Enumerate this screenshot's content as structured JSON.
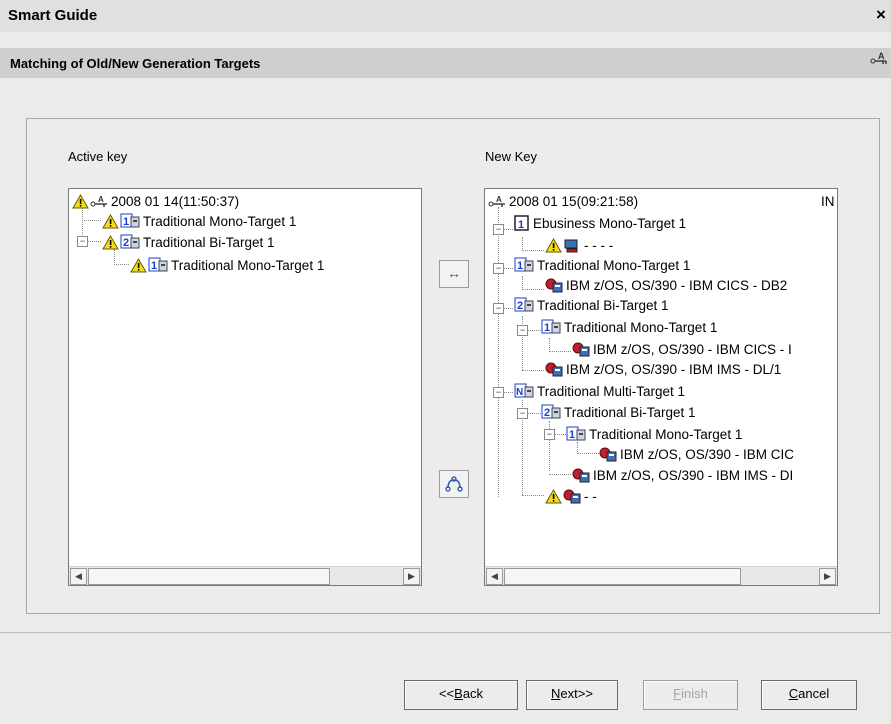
{
  "window": {
    "title": "Smart Guide",
    "close_label": "×"
  },
  "header": {
    "subtitle": "Matching of Old/New Generation Targets"
  },
  "left_panel": {
    "label": "Active key",
    "nodes": [
      {
        "text": "2008 01 14(11:50:37)"
      },
      {
        "text": "Traditional Mono-Target 1"
      },
      {
        "text": "Traditional Bi-Target 1"
      },
      {
        "text": "Traditional Mono-Target 1"
      }
    ]
  },
  "right_panel": {
    "label": "New Key",
    "nodes": [
      {
        "text": "2008 01 15(09:21:58)"
      },
      {
        "text": "IN"
      },
      {
        "text": "Ebusiness Mono-Target 1"
      },
      {
        "text": "- - - -"
      },
      {
        "text": "Traditional Mono-Target 1"
      },
      {
        "text": "IBM z/OS, OS/390 - IBM CICS - DB2"
      },
      {
        "text": "Traditional Bi-Target 1"
      },
      {
        "text": "Traditional Mono-Target 1"
      },
      {
        "text": "IBM z/OS, OS/390 - IBM CICS - I"
      },
      {
        "text": "IBM z/OS, OS/390 - IBM IMS - DL/1"
      },
      {
        "text": "Traditional Multi-Target 1"
      },
      {
        "text": "Traditional Bi-Target 1"
      },
      {
        "text": "Traditional Mono-Target 1"
      },
      {
        "text": "IBM z/OS, OS/390 - IBM CIC"
      },
      {
        "text": "IBM z/OS, OS/390 - IBM IMS - DI"
      },
      {
        "text": "- -"
      }
    ]
  },
  "middle_buttons": {
    "match": "↔",
    "unmatch": "unlink-icon"
  },
  "footer": {
    "back": {
      "prefix": "<<",
      "key": "B",
      "rest": "ack"
    },
    "next": {
      "key": "N",
      "rest": "ext>>"
    },
    "finish": {
      "key": "F",
      "rest": "inish"
    },
    "cancel": {
      "key": "C",
      "rest": "ancel"
    }
  },
  "colors": {
    "warning": "#f2dd1c",
    "target_blue": "#1d3ec9",
    "db_red": "#c71c2a",
    "background": "#ebebeb"
  }
}
